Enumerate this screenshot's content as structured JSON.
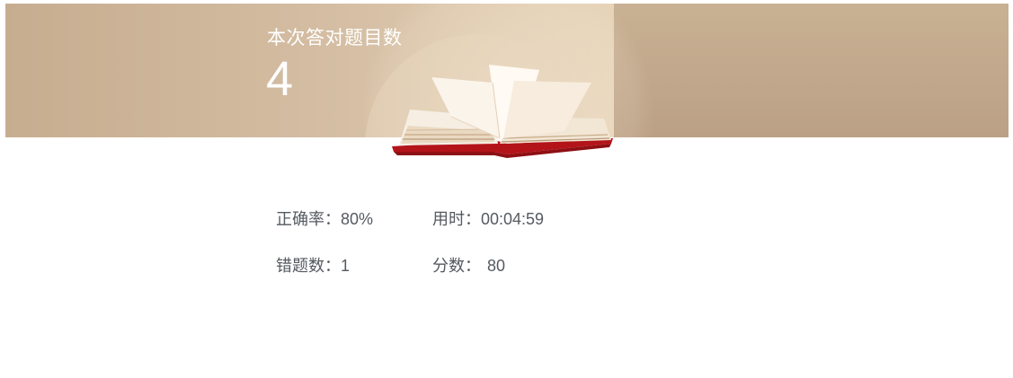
{
  "banner": {
    "title": "本次答对题目数",
    "count": "4"
  },
  "stats": {
    "accuracy": {
      "label": "正确率：",
      "value": "80%"
    },
    "time": {
      "label": "用时：",
      "value": "00:04:59"
    },
    "wrong": {
      "label": "错题数：",
      "value": "1"
    },
    "score": {
      "label": "分数：",
      "value": "80"
    }
  },
  "icons": {
    "book": "open-book-icon"
  },
  "colors": {
    "banner": "#c4a98a",
    "book_cover": "#b3141a",
    "text": "#555a60"
  }
}
